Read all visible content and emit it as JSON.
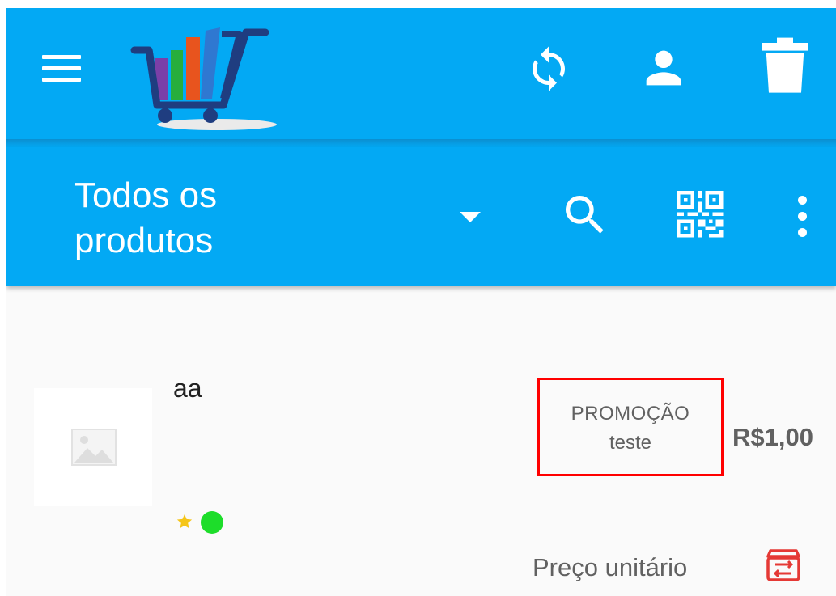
{
  "app": {
    "accent_color": "#03a9f4"
  },
  "appbar": {
    "icons": {
      "menu": "menu-icon",
      "logo": "shopping-cart-logo",
      "sync": "sync-icon",
      "user": "user-icon",
      "trash": "trash-icon"
    }
  },
  "toolbar": {
    "category_label": "Todos os produtos",
    "icons": {
      "dropdown": "dropdown-arrow-icon",
      "search": "search-icon",
      "qr": "qr-code-icon",
      "more": "more-vertical-icon"
    }
  },
  "product": {
    "name": "aa",
    "promo_label": "PROMOÇÃO",
    "promo_name": "teste",
    "price": "R$1,00",
    "unit_label": "Preço unitário",
    "status_color": "#1ddd2a",
    "promo_border_color": "#ff0000",
    "icons": {
      "thumbnail": "image-placeholder-icon",
      "favorite": "star-icon",
      "exchange": "exchange-icon"
    }
  }
}
